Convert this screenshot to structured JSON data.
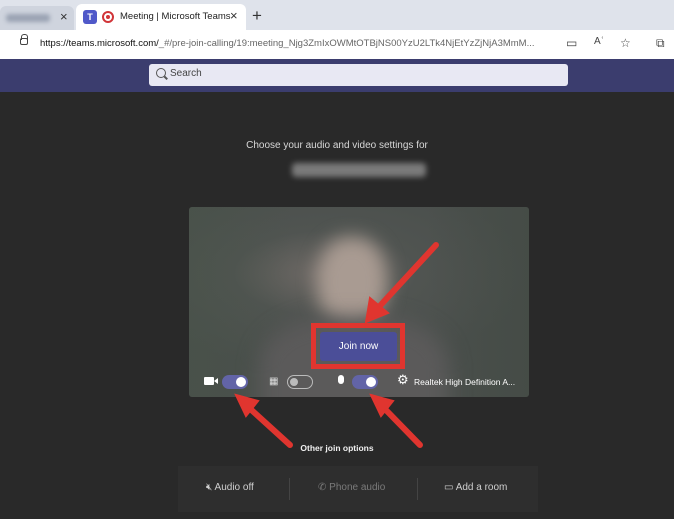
{
  "browser": {
    "prev_tab_close": "×",
    "active_tab": {
      "title": "Meeting | Microsoft Teams",
      "close": "×"
    },
    "new_tab": "+",
    "url_host": "https://teams.microsoft.com/",
    "url_path": "_#/pre-join-calling/19:meeting_Njg3ZmIxOWMtOTBjNS00YzU2LTk4NjEtYzZjNjA3MmM...",
    "toolbar_icons": [
      "camera-icon",
      "read-aloud-icon",
      "favorites-icon",
      "collections-icon"
    ],
    "read_aloud_label": "Aʿ",
    "favorites_label": "☆",
    "collections_label": "⧉",
    "camera_label": "▭"
  },
  "teams": {
    "search_placeholder": "Search",
    "heading": "Choose your audio and video settings for",
    "join_button": "Join now",
    "camera_on": true,
    "background_blur_on": false,
    "mic_on": true,
    "blur_icon": "▦",
    "gear_icon": "⚙",
    "device_label": "Realtek High Definition A...",
    "other_options_heading": "Other join options",
    "options": {
      "audio_off": "Audio off",
      "audio_off_icon": "🔇︎",
      "phone_audio": "Phone audio",
      "phone_icon": "✆",
      "add_room": "Add a room",
      "room_icon": "▭"
    }
  },
  "colors": {
    "teams_purple": "#6264a7",
    "join_button": "#4b4e98",
    "annotation_red": "#e0352f"
  }
}
